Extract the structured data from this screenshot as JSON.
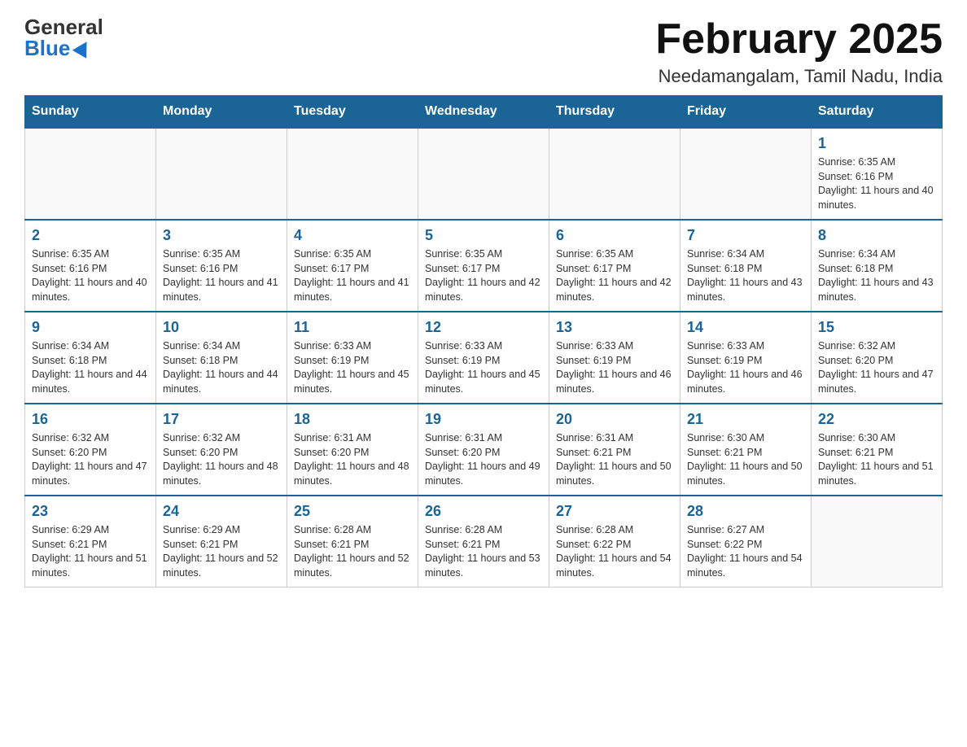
{
  "header": {
    "logo_general": "General",
    "logo_blue": "Blue",
    "month_title": "February 2025",
    "location": "Needamangalam, Tamil Nadu, India"
  },
  "days_of_week": [
    "Sunday",
    "Monday",
    "Tuesday",
    "Wednesday",
    "Thursday",
    "Friday",
    "Saturday"
  ],
  "weeks": [
    [
      {
        "day": "",
        "info": ""
      },
      {
        "day": "",
        "info": ""
      },
      {
        "day": "",
        "info": ""
      },
      {
        "day": "",
        "info": ""
      },
      {
        "day": "",
        "info": ""
      },
      {
        "day": "",
        "info": ""
      },
      {
        "day": "1",
        "info": "Sunrise: 6:35 AM\nSunset: 6:16 PM\nDaylight: 11 hours and 40 minutes."
      }
    ],
    [
      {
        "day": "2",
        "info": "Sunrise: 6:35 AM\nSunset: 6:16 PM\nDaylight: 11 hours and 40 minutes."
      },
      {
        "day": "3",
        "info": "Sunrise: 6:35 AM\nSunset: 6:16 PM\nDaylight: 11 hours and 41 minutes."
      },
      {
        "day": "4",
        "info": "Sunrise: 6:35 AM\nSunset: 6:17 PM\nDaylight: 11 hours and 41 minutes."
      },
      {
        "day": "5",
        "info": "Sunrise: 6:35 AM\nSunset: 6:17 PM\nDaylight: 11 hours and 42 minutes."
      },
      {
        "day": "6",
        "info": "Sunrise: 6:35 AM\nSunset: 6:17 PM\nDaylight: 11 hours and 42 minutes."
      },
      {
        "day": "7",
        "info": "Sunrise: 6:34 AM\nSunset: 6:18 PM\nDaylight: 11 hours and 43 minutes."
      },
      {
        "day": "8",
        "info": "Sunrise: 6:34 AM\nSunset: 6:18 PM\nDaylight: 11 hours and 43 minutes."
      }
    ],
    [
      {
        "day": "9",
        "info": "Sunrise: 6:34 AM\nSunset: 6:18 PM\nDaylight: 11 hours and 44 minutes."
      },
      {
        "day": "10",
        "info": "Sunrise: 6:34 AM\nSunset: 6:18 PM\nDaylight: 11 hours and 44 minutes."
      },
      {
        "day": "11",
        "info": "Sunrise: 6:33 AM\nSunset: 6:19 PM\nDaylight: 11 hours and 45 minutes."
      },
      {
        "day": "12",
        "info": "Sunrise: 6:33 AM\nSunset: 6:19 PM\nDaylight: 11 hours and 45 minutes."
      },
      {
        "day": "13",
        "info": "Sunrise: 6:33 AM\nSunset: 6:19 PM\nDaylight: 11 hours and 46 minutes."
      },
      {
        "day": "14",
        "info": "Sunrise: 6:33 AM\nSunset: 6:19 PM\nDaylight: 11 hours and 46 minutes."
      },
      {
        "day": "15",
        "info": "Sunrise: 6:32 AM\nSunset: 6:20 PM\nDaylight: 11 hours and 47 minutes."
      }
    ],
    [
      {
        "day": "16",
        "info": "Sunrise: 6:32 AM\nSunset: 6:20 PM\nDaylight: 11 hours and 47 minutes."
      },
      {
        "day": "17",
        "info": "Sunrise: 6:32 AM\nSunset: 6:20 PM\nDaylight: 11 hours and 48 minutes."
      },
      {
        "day": "18",
        "info": "Sunrise: 6:31 AM\nSunset: 6:20 PM\nDaylight: 11 hours and 48 minutes."
      },
      {
        "day": "19",
        "info": "Sunrise: 6:31 AM\nSunset: 6:20 PM\nDaylight: 11 hours and 49 minutes."
      },
      {
        "day": "20",
        "info": "Sunrise: 6:31 AM\nSunset: 6:21 PM\nDaylight: 11 hours and 50 minutes."
      },
      {
        "day": "21",
        "info": "Sunrise: 6:30 AM\nSunset: 6:21 PM\nDaylight: 11 hours and 50 minutes."
      },
      {
        "day": "22",
        "info": "Sunrise: 6:30 AM\nSunset: 6:21 PM\nDaylight: 11 hours and 51 minutes."
      }
    ],
    [
      {
        "day": "23",
        "info": "Sunrise: 6:29 AM\nSunset: 6:21 PM\nDaylight: 11 hours and 51 minutes."
      },
      {
        "day": "24",
        "info": "Sunrise: 6:29 AM\nSunset: 6:21 PM\nDaylight: 11 hours and 52 minutes."
      },
      {
        "day": "25",
        "info": "Sunrise: 6:28 AM\nSunset: 6:21 PM\nDaylight: 11 hours and 52 minutes."
      },
      {
        "day": "26",
        "info": "Sunrise: 6:28 AM\nSunset: 6:21 PM\nDaylight: 11 hours and 53 minutes."
      },
      {
        "day": "27",
        "info": "Sunrise: 6:28 AM\nSunset: 6:22 PM\nDaylight: 11 hours and 54 minutes."
      },
      {
        "day": "28",
        "info": "Sunrise: 6:27 AM\nSunset: 6:22 PM\nDaylight: 11 hours and 54 minutes."
      },
      {
        "day": "",
        "info": ""
      }
    ]
  ]
}
